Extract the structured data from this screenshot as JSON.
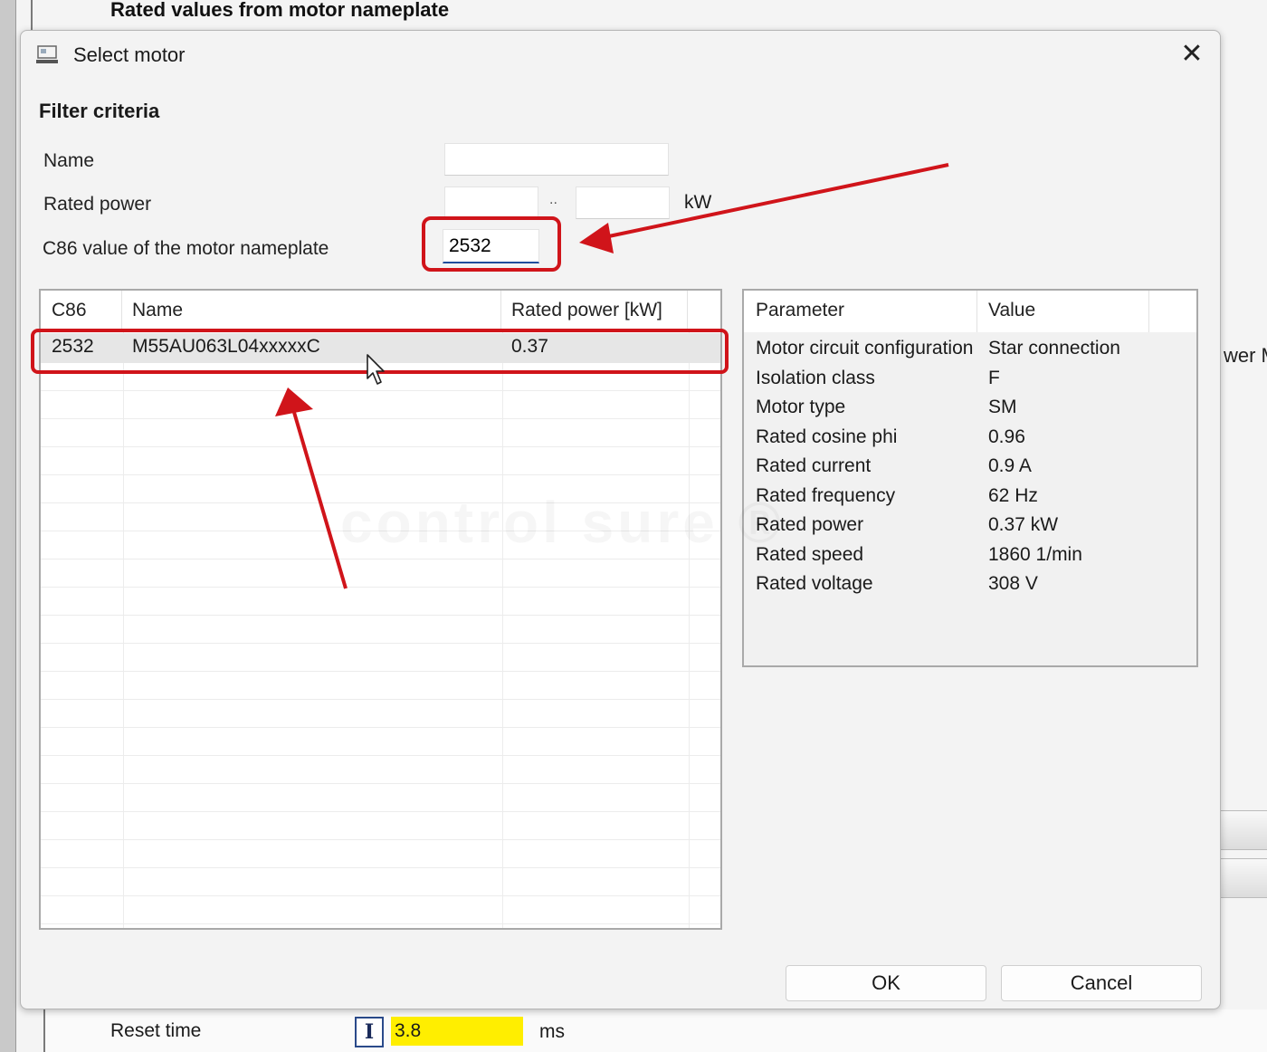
{
  "background": {
    "section_title": "Rated values from motor nameplate",
    "right_partial_text": "wer Ma",
    "reset_time": {
      "label": "Reset time",
      "indicator": "I",
      "value": "3.8",
      "unit": "ms"
    }
  },
  "dialog": {
    "title": "Select motor",
    "icon": "monitor-icon",
    "close_glyph": "✕",
    "filter": {
      "heading": "Filter criteria",
      "name_label": "Name",
      "name_value": "",
      "rated_power_label": "Rated power",
      "rated_power_min": "",
      "range_separator": "..",
      "rated_power_max": "",
      "rated_power_unit": "kW",
      "c86_label": "C86 value of the motor nameplate",
      "c86_value": "2532"
    },
    "motor_table": {
      "columns": [
        "C86",
        "Name",
        "Rated power [kW]"
      ],
      "rows": [
        {
          "c86": "2532",
          "name": "M55AU063L04xxxxxC",
          "rated_power": "0.37"
        }
      ]
    },
    "parameter_table": {
      "columns": [
        "Parameter",
        "Value"
      ],
      "rows": [
        {
          "parameter": "Motor circuit configuration",
          "value": "Star connection"
        },
        {
          "parameter": "Isolation class",
          "value": "F"
        },
        {
          "parameter": "Motor type",
          "value": "SM"
        },
        {
          "parameter": "Rated cosine phi",
          "value": "0.96"
        },
        {
          "parameter": "Rated current",
          "value": "0.9 A"
        },
        {
          "parameter": "Rated frequency",
          "value": "62 Hz"
        },
        {
          "parameter": "Rated power",
          "value": "0.37 kW"
        },
        {
          "parameter": "Rated speed",
          "value": "1860 1/min"
        },
        {
          "parameter": "Rated voltage",
          "value": "308 V"
        }
      ]
    },
    "buttons": {
      "ok": "OK",
      "cancel": "Cancel"
    }
  },
  "watermark": "control sure ®",
  "colors": {
    "annotation_red": "#d0141a",
    "active_input_underline": "#1f4e9c",
    "reset_value_bg": "#ffee00",
    "selected_row_bg": "#e6e6e6"
  }
}
